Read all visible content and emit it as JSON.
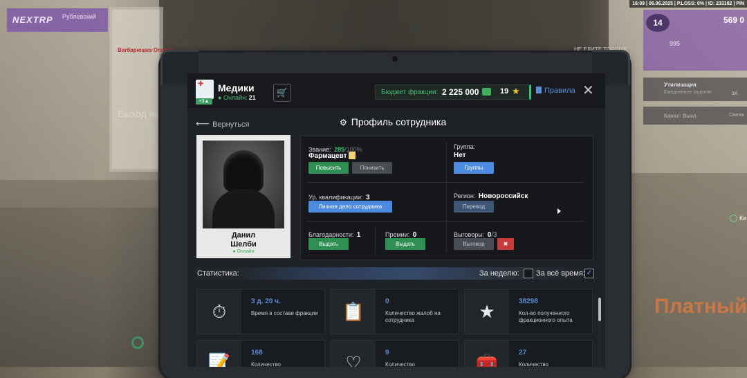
{
  "hud": {
    "brand": "NEXTRP",
    "server": "Рублевский",
    "status": "16:09 | 06.06.2025 | P.LOSS: 0% | ID: 233182 | PIN",
    "level": "14",
    "money": "569 0",
    "exp_small": "995",
    "util_title": "Утилизация",
    "util_sub": "Ежедневное задание",
    "util_k": "1K",
    "channel": "Канал: Выкл.",
    "channel_right": "Смена"
  },
  "scene": {
    "exit_text": "Выход на",
    "nick": "Barбарюшка Оганов",
    "sign": "НЕ ЕДИТЕ ТОРОШЕ",
    "paid_text": "Платный",
    "ki_text": "Ки"
  },
  "header": {
    "faction_badge": "+3▲",
    "faction_name": "Медики",
    "online_label": "Онлайн:",
    "online_count": "21",
    "cart_icon": "🛒",
    "budget_label": "Бюджет фракции:",
    "budget_amount": "2 225 000",
    "stars_count": "19",
    "star_icon": "★",
    "rules_label": "Правила",
    "close_icon": "✕"
  },
  "nav": {
    "back_label": "Вернуться",
    "back_icon": "⟵",
    "title": "Профиль сотрудника",
    "gear_icon": "⚙"
  },
  "profile": {
    "name": "Данил Шелби",
    "online": "● Онлайн"
  },
  "info": {
    "rank_label": "Звание:",
    "rank_points": "285",
    "rank_max": "/100%",
    "rank_name": "Фармацевт",
    "promote": "Повысить",
    "demote": "Понизить",
    "group_label": "Группа:",
    "group_value": "Нет",
    "groups_btn": "Группы",
    "qual_label": "Ур. квалификации:",
    "qual_value": "3",
    "dossier_btn": "Личное дело сотрудника",
    "region_label": "Регион:",
    "region_value": "Новороссийск",
    "transfer_btn": "Перевод",
    "thanks_label": "Благодарности:",
    "thanks_value": "1",
    "thanks_btn": "Выдать",
    "bonus_label": "Премии:",
    "bonus_value": "0",
    "bonus_btn": "Выдать",
    "rep_label": "Выговоры:",
    "rep_value": "0",
    "rep_max": "/3",
    "rep_btn": "Выговор",
    "rep_remove_icon": "✖"
  },
  "stats": {
    "title": "Статистика:",
    "week_label": "За неделю:",
    "week_checked": "",
    "all_label": "За всё время:",
    "all_checked": "✓",
    "tiles": [
      {
        "icon": "⏱",
        "value": "3 д. 20 ч.",
        "label": "Время в составе фракции"
      },
      {
        "icon": "📋",
        "value": "0",
        "label": "Количество жалоб на сотрудника"
      },
      {
        "icon": "★",
        "value": "38298",
        "label": "Кол-во полученного фракционного опыта"
      },
      {
        "icon": "📝",
        "value": "168",
        "label": "Количество"
      },
      {
        "icon": "♡",
        "value": "9",
        "label": "Количество"
      },
      {
        "icon": "🧰",
        "value": "27",
        "label": "Количество"
      }
    ]
  }
}
